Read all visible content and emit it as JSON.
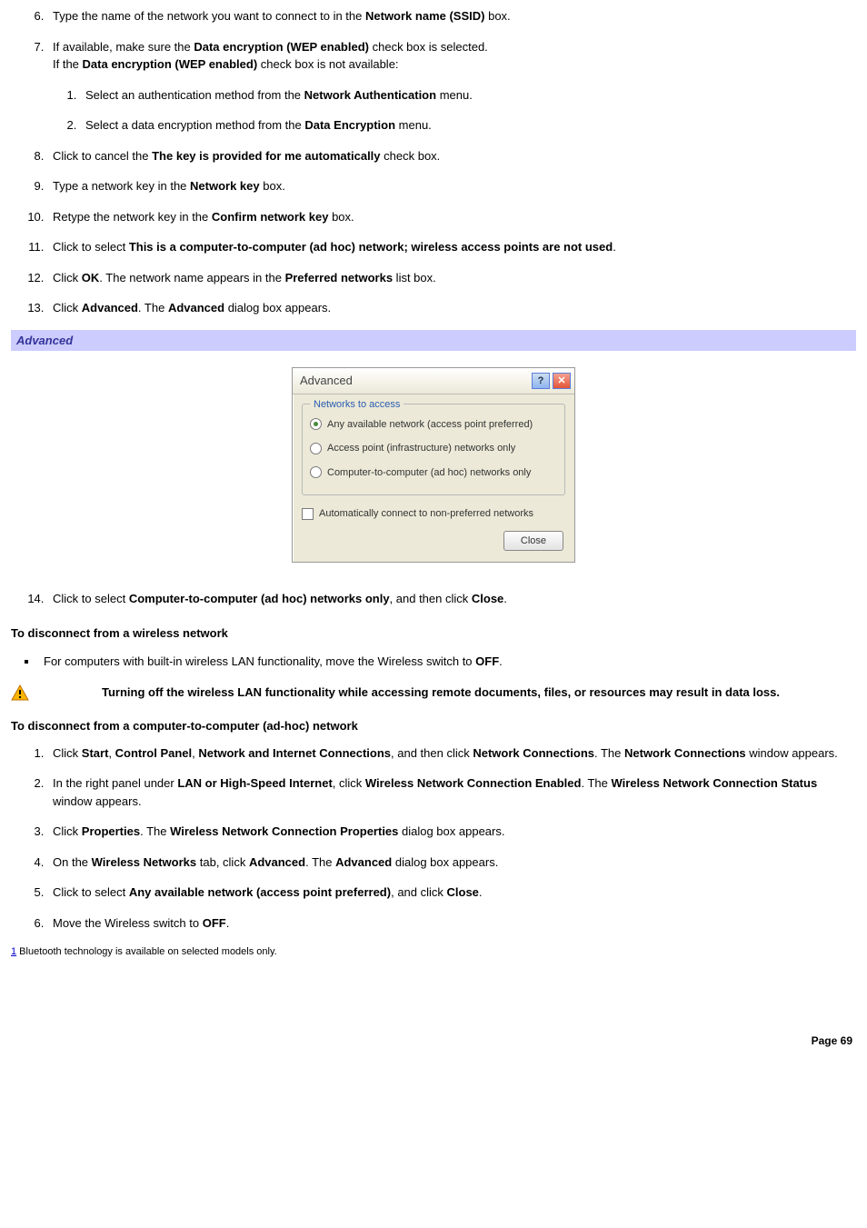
{
  "steps1": {
    "s6": {
      "pre": "Type the name of the network you want to connect to in the ",
      "b1": "Network name (SSID)",
      "post": " box."
    },
    "s7": {
      "line1_pre": "If available, make sure the ",
      "line1_b": "Data encryption (WEP enabled)",
      "line1_post": " check box is selected.",
      "line2_pre": "If the ",
      "line2_b": "Data encryption (WEP enabled)",
      "line2_post": " check box is not available:",
      "sub1_pre": "Select an authentication method from the ",
      "sub1_b": "Network Authentication",
      "sub1_post": " menu.",
      "sub2_pre": "Select a data encryption method from the ",
      "sub2_b": "Data Encryption",
      "sub2_post": " menu."
    },
    "s8": {
      "pre": "Click to cancel the ",
      "b1": "The key is provided for me automatically",
      "post": " check box."
    },
    "s9": {
      "pre": "Type a network key in the ",
      "b1": "Network key",
      "post": " box."
    },
    "s10": {
      "pre": "Retype the network key in the ",
      "b1": "Confirm network key",
      "post": " box."
    },
    "s11": {
      "pre": "Click to select ",
      "b1": "This is a computer-to-computer (ad hoc) network; wireless access points are not used",
      "post": "."
    },
    "s12": {
      "pre": "Click ",
      "b1": "OK",
      "mid": ". The network name appears in the ",
      "b2": "Preferred networks",
      "post": " list box."
    },
    "s13": {
      "pre": "Click ",
      "b1": "Advanced",
      "mid": ". The ",
      "b2": "Advanced",
      "post": " dialog box appears."
    }
  },
  "section_bar": "Advanced",
  "dialog": {
    "title": "Advanced",
    "group_legend": "Networks to access",
    "opt1": "Any available network (access point preferred)",
    "opt2": "Access point (infrastructure) networks only",
    "opt3": "Computer-to-computer (ad hoc) networks only",
    "checkbox": "Automatically connect to non-preferred networks",
    "close": "Close"
  },
  "step14": {
    "pre": "Click to select ",
    "b1": "Computer-to-computer (ad hoc) networks only",
    "mid": ", and then click ",
    "b2": "Close",
    "post": "."
  },
  "disconnect_heading": "To disconnect from a wireless network",
  "disconnect_bullet": {
    "pre": "For computers with built-in wireless LAN functionality, move the Wireless switch to ",
    "b1": "OFF",
    "post": "."
  },
  "warning": "Turning off the wireless LAN functionality while accessing remote documents, files, or resources may result in data loss.",
  "adhoc_heading": "To disconnect from a computer-to-computer (ad-hoc) network",
  "steps2": {
    "a1": {
      "pre": "Click ",
      "b1": "Start",
      "c1": ", ",
      "b2": "Control Panel",
      "c2": ", ",
      "b3": "Network and Internet Connections",
      "c3": ", and then click ",
      "b4": "Network Connections",
      "c4": ". The ",
      "b5": "Network Connections",
      "post": " window appears."
    },
    "a2": {
      "pre": "In the right panel under ",
      "b1": "LAN or High-Speed Internet",
      "c1": ", click ",
      "b2": "Wireless Network Connection Enabled",
      "c2": ". The ",
      "b3": "Wireless Network Connection Status",
      "post": " window appears."
    },
    "a3": {
      "pre": "Click ",
      "b1": "Properties",
      "c1": ". The ",
      "b2": "Wireless Network Connection Properties",
      "post": " dialog box appears."
    },
    "a4": {
      "pre": "On the ",
      "b1": "Wireless Networks",
      "c1": " tab, click ",
      "b2": "Advanced",
      "c2": ". The ",
      "b3": "Advanced",
      "post": " dialog box appears."
    },
    "a5": {
      "pre": "Click to select ",
      "b1": "Any available network (access point preferred)",
      "c1": ", and click ",
      "b2": "Close",
      "post": "."
    },
    "a6": {
      "pre": "Move the Wireless switch to ",
      "b1": "OFF",
      "post": "."
    }
  },
  "footnote": {
    "link": "1",
    "text": " Bluetooth technology is available on selected models only."
  },
  "page": "Page 69"
}
